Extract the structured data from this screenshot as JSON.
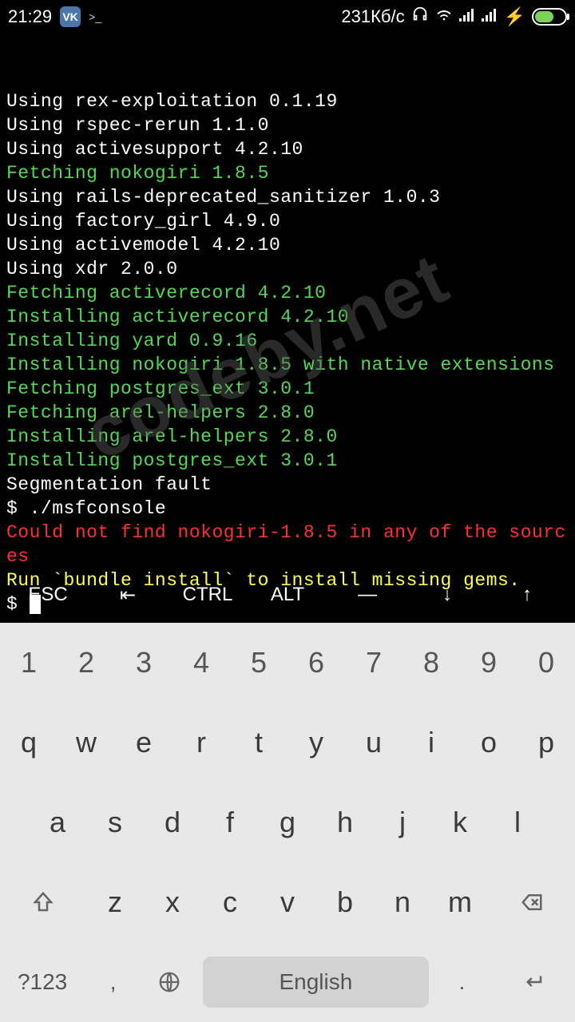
{
  "status": {
    "time": "21:29",
    "net_speed": "231Кб/с",
    "bolt": "⚡"
  },
  "terminal": {
    "lines": [
      {
        "text": "Using rex-exploitation 0.1.19",
        "cls": ""
      },
      {
        "text": "Using rspec-rerun 1.1.0",
        "cls": ""
      },
      {
        "text": "Using activesupport 4.2.10",
        "cls": ""
      },
      {
        "text": "Fetching nokogiri 1.8.5",
        "cls": "green"
      },
      {
        "text": "Using rails-deprecated_sanitizer 1.0.3",
        "cls": ""
      },
      {
        "text": "Using factory_girl 4.9.0",
        "cls": ""
      },
      {
        "text": "Using activemodel 4.2.10",
        "cls": ""
      },
      {
        "text": "Using xdr 2.0.0",
        "cls": ""
      },
      {
        "text": "Fetching activerecord 4.2.10",
        "cls": "green"
      },
      {
        "text": "Installing activerecord 4.2.10",
        "cls": "green"
      },
      {
        "text": "Installing yard 0.9.16",
        "cls": "green"
      },
      {
        "text": "Installing nokogiri 1.8.5 with native extensions",
        "cls": "green"
      },
      {
        "text": "Fetching postgres_ext 3.0.1",
        "cls": "green"
      },
      {
        "text": "Fetching arel-helpers 2.8.0",
        "cls": "green"
      },
      {
        "text": "Installing arel-helpers 2.8.0",
        "cls": "green"
      },
      {
        "text": "Installing postgres_ext 3.0.1",
        "cls": "green"
      },
      {
        "text": "Segmentation fault",
        "cls": ""
      },
      {
        "text": "$ ./msfconsole",
        "cls": ""
      },
      {
        "text": "Could not find nokogiri-1.8.5 in any of the sources",
        "cls": "red"
      },
      {
        "text": "Run `bundle install` to install missing gems.",
        "cls": "yellow"
      }
    ],
    "prompt": "$ "
  },
  "watermark": "codeby.net",
  "extra_keys": [
    "ESC",
    "⇤",
    "CTRL",
    "ALT",
    "—",
    "↓",
    "↑"
  ],
  "keyboard": {
    "row0": [
      "1",
      "2",
      "3",
      "4",
      "5",
      "6",
      "7",
      "8",
      "9",
      "0"
    ],
    "row1": [
      "q",
      "w",
      "e",
      "r",
      "t",
      "y",
      "u",
      "i",
      "o",
      "p"
    ],
    "row2": [
      "a",
      "s",
      "d",
      "f",
      "g",
      "h",
      "j",
      "k",
      "l"
    ],
    "row3_letters": [
      "z",
      "x",
      "c",
      "v",
      "b",
      "n",
      "m"
    ],
    "symbol_key": "?123",
    "comma": ",",
    "period": ".",
    "language": "English"
  }
}
